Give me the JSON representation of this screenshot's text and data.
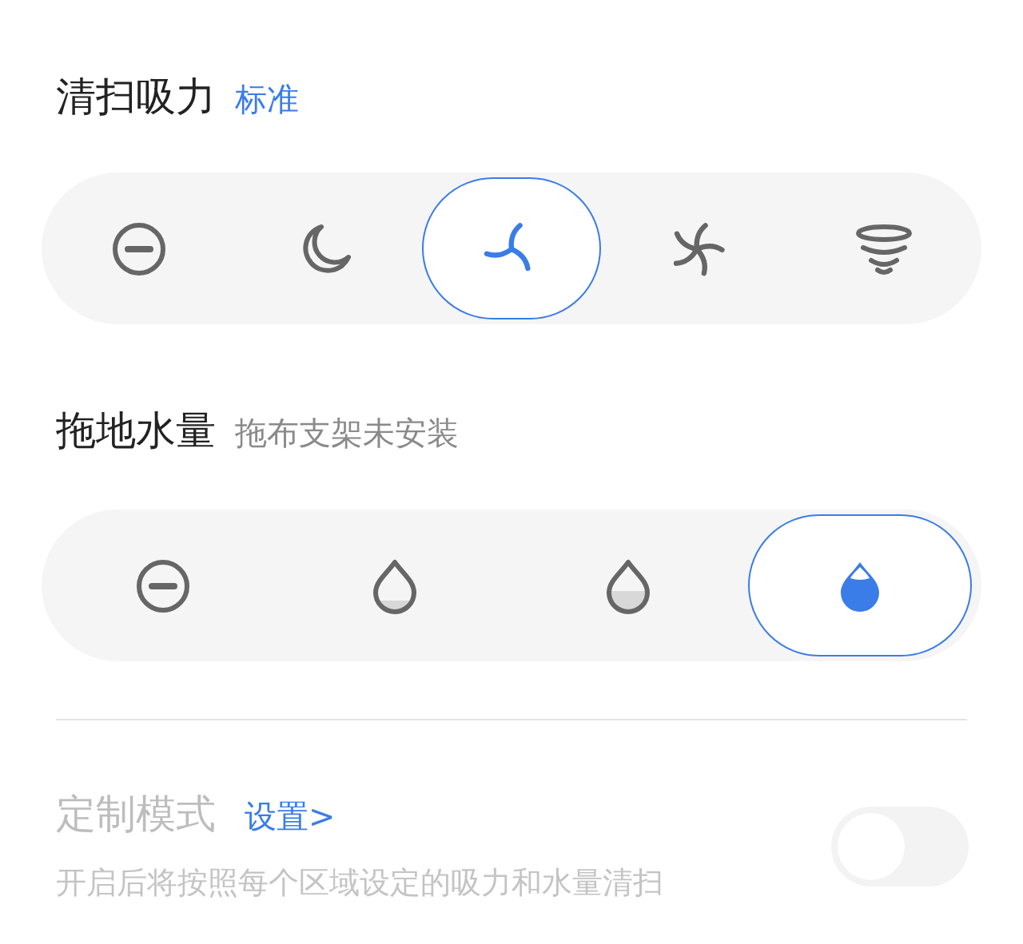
{
  "suction": {
    "title": "清扫吸力",
    "value": "标准",
    "options": [
      {
        "kind": "off",
        "selected": false
      },
      {
        "kind": "quiet",
        "selected": false
      },
      {
        "kind": "standard",
        "selected": true
      },
      {
        "kind": "turbo",
        "selected": false
      },
      {
        "kind": "max",
        "selected": false
      }
    ]
  },
  "water": {
    "title": "拖地水量",
    "note": "拖布支架未安装",
    "options": [
      {
        "kind": "off",
        "selected": false
      },
      {
        "kind": "low",
        "selected": false
      },
      {
        "kind": "medium",
        "selected": false
      },
      {
        "kind": "high",
        "selected": true
      }
    ]
  },
  "custom": {
    "title": "定制模式",
    "link": "设置>",
    "description": "开启后将按照每个区域设定的吸力和水量清扫",
    "disabled": true,
    "on": false
  }
}
